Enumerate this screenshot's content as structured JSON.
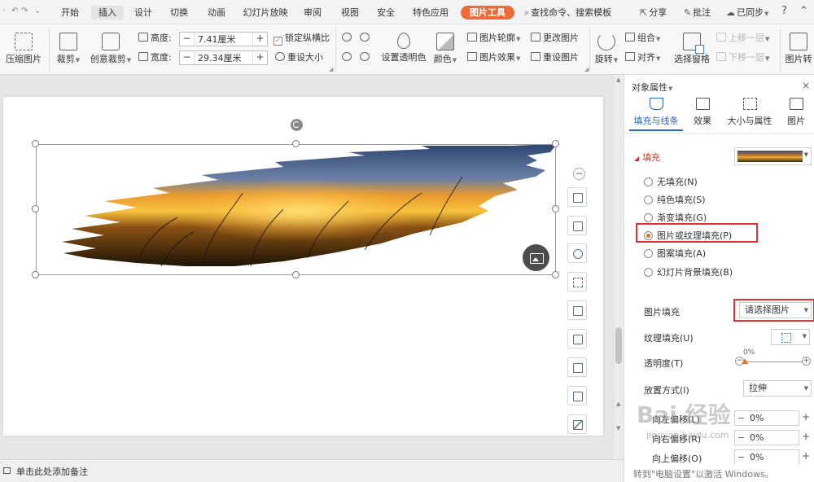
{
  "menu": {
    "quick": [
      "◦",
      "↶",
      "↷",
      "⌄"
    ],
    "tabs": [
      "开始",
      "插入",
      "设计",
      "切换",
      "动画",
      "幻灯片放映",
      "审阅",
      "视图",
      "安全",
      "特色应用",
      "图片工具"
    ],
    "active_tab": "插入",
    "tool_tab": "图片工具",
    "search": "查找命令、搜索模板",
    "share": "分享",
    "comment": "批注",
    "sync": "已同步",
    "help": "?",
    "collapse": "⌃"
  },
  "ribbon": {
    "compress": "压缩图片",
    "crop": "裁剪",
    "creative_crop": "创意裁剪",
    "height_label": "高度:",
    "height_value": "7.41厘米",
    "width_label": "宽度:",
    "width_value": "29.34厘米",
    "lock_ratio": "锁定纵横比",
    "reset_size": "重设大小",
    "set_transparent": "设置透明色",
    "color": "颜色",
    "outline": "图片轮廓",
    "effect": "图片效果",
    "change_pic": "更改图片",
    "reset_pic": "重设图片",
    "rotate": "旋转",
    "group": "组合",
    "align": "对齐",
    "select_pane": "选择窗格",
    "bring_forward": "上移一层",
    "send_backward": "下移一层",
    "pic_convert": "图片转"
  },
  "notes": {
    "placeholder": "单击此处添加备注"
  },
  "pane": {
    "title": "对象属性",
    "close": "×",
    "tabs": [
      "填充与线条",
      "效果",
      "大小与属性",
      "图片"
    ],
    "fill_section": "填充",
    "fill_options": [
      "无填充(N)",
      "纯色填充(S)",
      "渐变填充(G)",
      "图片或纹理填充(P)",
      "图案填充(A)",
      "幻灯片背景填充(B)"
    ],
    "picture_fill_label": "图片填充",
    "picture_fill_value": "请选择图片",
    "texture_fill_label": "纹理填充(U)",
    "transparency_label": "透明度(T)",
    "transparency_value": "0%",
    "placement_label": "放置方式(I)",
    "placement_value": "拉伸",
    "offset_left_label": "向左偏移(L)",
    "offset_left_value": "0%",
    "offset_right_label": "向右偏移(R)",
    "offset_right_value": "0%",
    "offset_third_label": "向上偏移(O)",
    "offset_third_value": "0%"
  },
  "watermark": {
    "brand": "Bai 经验",
    "url": "jingyan.baidu.com"
  },
  "activation": "转到\"电脑设置\"以激活 Windows。",
  "colors": {
    "accent": "#f06a35",
    "tab_blue": "#2a63c9",
    "highlight_red": "#e03030",
    "section_red": "#c93a1b"
  }
}
